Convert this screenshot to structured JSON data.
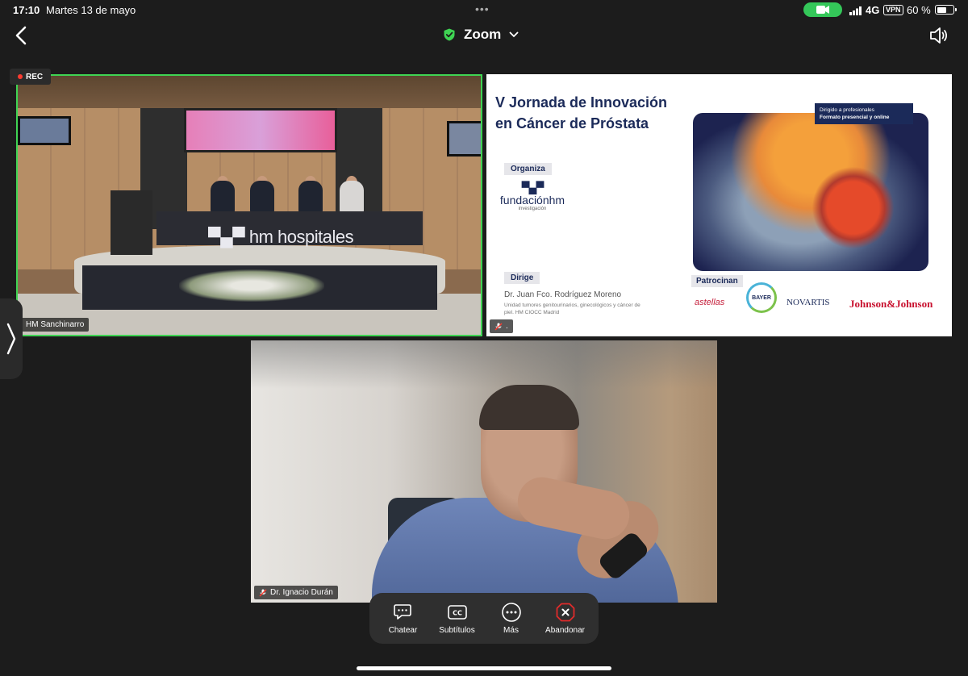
{
  "status_bar": {
    "time": "17:10",
    "date": "Martes 13 de mayo",
    "network": "4G",
    "vpn": "VPN",
    "battery_percent": "60 %",
    "battery_level": 0.6,
    "camera_active_color": "#34c759"
  },
  "header": {
    "title": "Zoom",
    "secure_color": "#3fd453",
    "back_icon": "chevron-left-icon",
    "audio_icon": "speaker-icon"
  },
  "recording": {
    "label": "REC",
    "dot_color": "#ff3b30"
  },
  "tiles": {
    "hm": {
      "name": "HM Sanchinarro",
      "active_speaker_border": "#3fd453",
      "scene_banner": "hm hospitales"
    },
    "slide": {
      "muted_label": ".",
      "title": "V Jornada de Innovación en Cáncer de Próstata",
      "organiza": "Organiza",
      "fundacion": "fundaciónhm",
      "fundacion_sub": "investigación",
      "note_line1": "Dirigido a profesionales",
      "note_line2": "Formato presencial y online",
      "dirige": "Dirige",
      "director": "Dr. Juan Fco. Rodríguez Moreno",
      "unit": "Unidad tumores genitourinarios, ginecológicos y cáncer de piel. HM CIOCC Madrid",
      "patrocinan": "Patrocinan",
      "sponsors": [
        "astellas",
        "BAYER",
        "NOVARTIS",
        "Johnson&Johnson"
      ]
    },
    "camera": {
      "name": "Dr. Ignacio Durán"
    }
  },
  "toolbar": {
    "items": [
      {
        "label": "Chatear",
        "icon": "chat-icon"
      },
      {
        "label": "Subtítulos",
        "icon": "cc-icon"
      },
      {
        "label": "Más",
        "icon": "more-icon"
      },
      {
        "label": "Abandonar",
        "icon": "leave-icon",
        "color": "#e02b2b"
      }
    ]
  }
}
